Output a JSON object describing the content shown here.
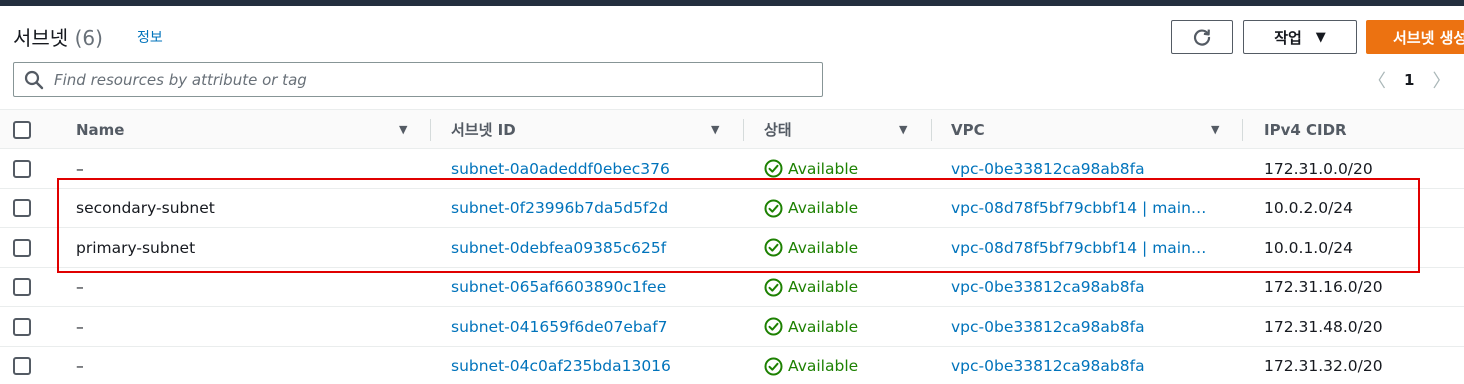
{
  "header": {
    "title": "서브넷",
    "count": "(6)",
    "info_label": "정보",
    "actions_label": "작업",
    "actions_caret": "▼",
    "create_label": "서브넷 생성"
  },
  "search": {
    "placeholder": "Find resources by attribute or tag",
    "value": ""
  },
  "pagination": {
    "prev": "〈",
    "page": "1",
    "next": "〉"
  },
  "columns": [
    "Name",
    "서브넷 ID",
    "상태",
    "VPC",
    "IPv4 CIDR"
  ],
  "rows": [
    {
      "name": "–",
      "subnet_id": "subnet-0a0adeddf0ebec376",
      "status": "Available",
      "vpc": "vpc-0be33812ca98ab8fa",
      "cidr": "172.31.0.0/20"
    },
    {
      "name": "secondary-subnet",
      "subnet_id": "subnet-0f23996b7da5d5f2d",
      "status": "Available",
      "vpc": "vpc-08d78f5bf79cbbf14 | main…",
      "cidr": "10.0.2.0/24"
    },
    {
      "name": "primary-subnet",
      "subnet_id": "subnet-0debfea09385c625f",
      "status": "Available",
      "vpc": "vpc-08d78f5bf79cbbf14 | main…",
      "cidr": "10.0.1.0/24"
    },
    {
      "name": "–",
      "subnet_id": "subnet-065af6603890c1fee",
      "status": "Available",
      "vpc": "vpc-0be33812ca98ab8fa",
      "cidr": "172.31.16.0/20"
    },
    {
      "name": "–",
      "subnet_id": "subnet-041659f6de07ebaf7",
      "status": "Available",
      "vpc": "vpc-0be33812ca98ab8fa",
      "cidr": "172.31.48.0/20"
    },
    {
      "name": "–",
      "subnet_id": "subnet-04c0af235bda13016",
      "status": "Available",
      "vpc": "vpc-0be33812ca98ab8fa",
      "cidr": "172.31.32.0/20"
    }
  ],
  "colors": {
    "link": "#0073bb",
    "available": "#1d8102",
    "primary_button": "#ec7211",
    "highlight": "#e00000"
  }
}
